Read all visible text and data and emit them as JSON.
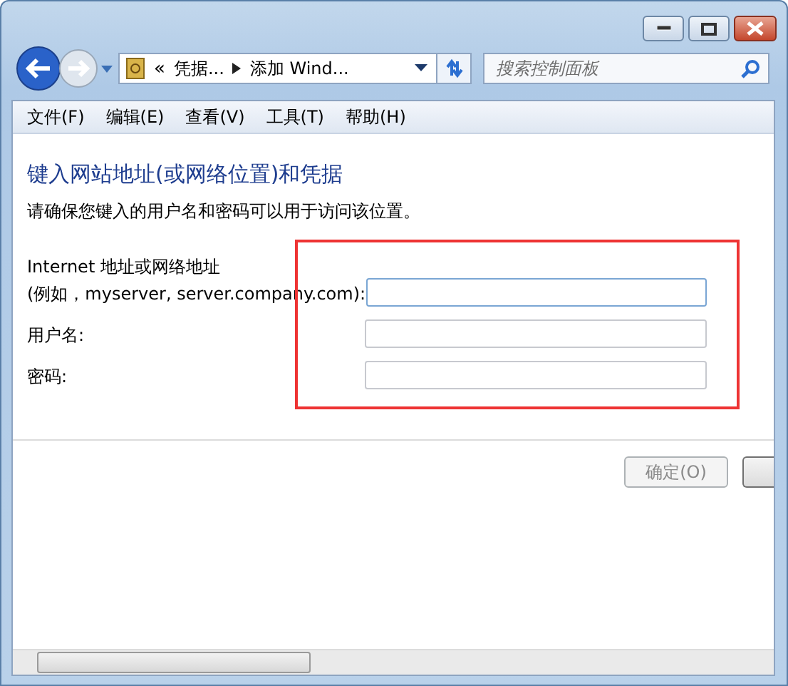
{
  "window": {
    "caption_buttons": [
      {
        "kind": "minimize"
      },
      {
        "kind": "maximize"
      },
      {
        "kind": "close"
      }
    ]
  },
  "address_bar": {
    "overflow": "«",
    "segments": [
      "凭据...",
      "添加 Wind..."
    ]
  },
  "search": {
    "placeholder": "搜索控制面板"
  },
  "menu": [
    "文件(F)",
    "编辑(E)",
    "查看(V)",
    "工具(T)",
    "帮助(H)"
  ],
  "heading": "键入网站地址(或网络位置)和凭据",
  "instruction": "请确保您键入的用户名和密码可以用于访问该位置。",
  "fields": [
    {
      "label_lines": [
        "Internet 地址或网络地址",
        "(例如，myserver, server.company.com):"
      ],
      "focused": true
    },
    {
      "label_lines": [
        "用户名:"
      ],
      "focused": false
    },
    {
      "label_lines": [
        "密码:"
      ],
      "focused": false
    }
  ],
  "buttons": [
    {
      "label": "确定(O)",
      "disabled": true
    }
  ]
}
